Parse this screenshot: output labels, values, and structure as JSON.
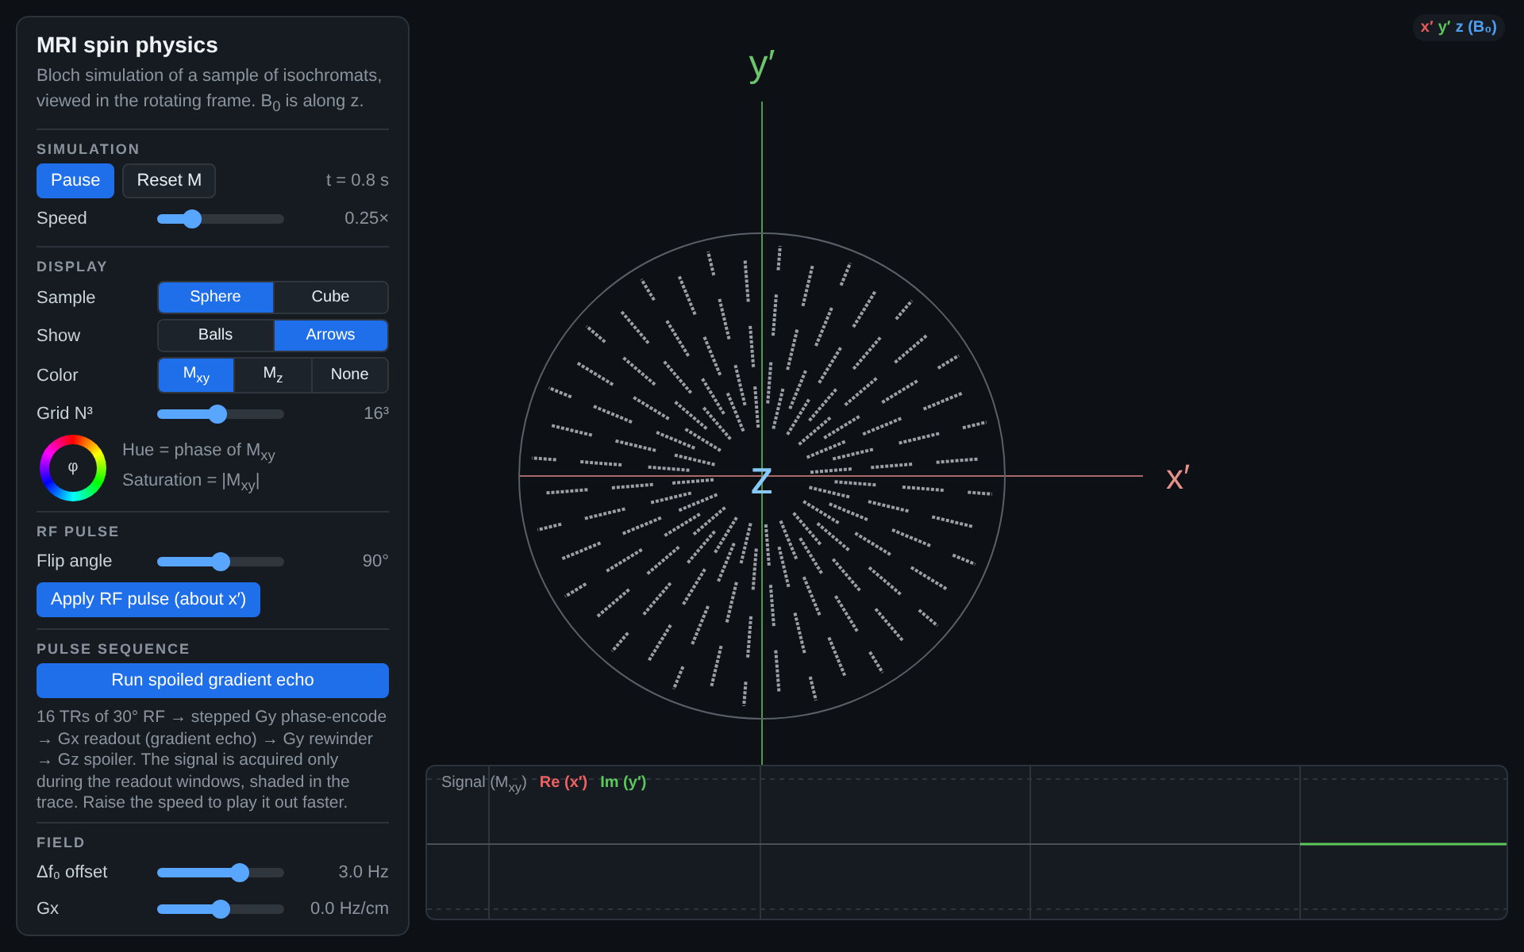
{
  "panel": {
    "title": "MRI spin physics",
    "description": "Bloch simulation of a sample of isochromats, viewed in the rotating frame. B$_{0}$ is along z.",
    "sections": [
      {
        "heading": "SIMULATION",
        "rows": [
          {
            "kind": "buttons",
            "buttons": [
              {
                "label": "Pause",
                "primary": true
              },
              {
                "label": "Reset M",
                "primary": false
              }
            ],
            "reading": "t = 0.8 s"
          },
          {
            "kind": "slider",
            "label": "Speed",
            "level": 0.28,
            "reading": "0.25×"
          }
        ]
      },
      {
        "heading": "DISPLAY",
        "rows": [
          {
            "kind": "segmented",
            "label": "Sample",
            "options": [
              {
                "label": "Sphere",
                "selected": true
              },
              {
                "label": "Cube",
                "selected": false
              }
            ]
          },
          {
            "kind": "segmented",
            "label": "Show",
            "options": [
              {
                "label": "Balls",
                "selected": false
              },
              {
                "label": "Arrows",
                "selected": true
              }
            ]
          },
          {
            "kind": "segmented",
            "label": "Color",
            "options": [
              {
                "label": "M$_{xy}$",
                "selected": true
              },
              {
                "label": "M$_{z}$",
                "selected": false
              },
              {
                "label": "None",
                "selected": false
              }
            ]
          },
          {
            "kind": "slider",
            "label": "Grid N³",
            "level": 0.47,
            "reading": "16³"
          },
          {
            "kind": "hue",
            "symbol": "φ",
            "lines": [
              "Hue = phase of M$_{xy}$",
              "Saturation = |M$_{xy}$|"
            ]
          }
        ]
      },
      {
        "heading": "RF PULSE",
        "rows": [
          {
            "kind": "slider",
            "label": "Flip angle",
            "level": 0.5,
            "reading": "90°"
          },
          {
            "kind": "button",
            "label": "Apply RF pulse (about x′)"
          }
        ]
      },
      {
        "heading": "PULSE SEQUENCE",
        "rows": [
          {
            "kind": "wide-button",
            "label": "Run spoiled gradient echo"
          },
          {
            "kind": "text",
            "text": "16 TRs of 30° RF → stepped Gy phase-encode → Gx readout (gradient echo) → Gy rewinder → Gz spoiler. The signal is acquired only during the readout windows, shaded in the trace. Raise the speed to play it out faster."
          }
        ]
      },
      {
        "heading": "FIELD",
        "rows": [
          {
            "kind": "slider",
            "label": "Δf₀ offset",
            "level": 0.65,
            "reading": "3.0 Hz"
          },
          {
            "kind": "slider",
            "label": "Gx",
            "level": 0.5,
            "reading": "0.0 Hz/cm"
          }
        ]
      }
    ]
  },
  "viewport": {
    "axes": [
      {
        "label": "y′",
        "color": "#6cc46c"
      },
      {
        "label": "x′",
        "color": "#e8908a"
      },
      {
        "label": "z",
        "color": "#86c8f8"
      }
    ],
    "legend": [
      {
        "label": "x′",
        "color": "#e85a5a"
      },
      {
        "label": "y′",
        "color": "#5cc45c"
      },
      {
        "label": "z (B₀)",
        "color": "#4d9ef0"
      }
    ]
  },
  "signal": {
    "title": "Signal (M$_{xy}$)",
    "series": [
      {
        "label": "Re (x′)",
        "color": "#f06060"
      },
      {
        "label": "Im (y′)",
        "color": "#5cc85c"
      }
    ]
  }
}
